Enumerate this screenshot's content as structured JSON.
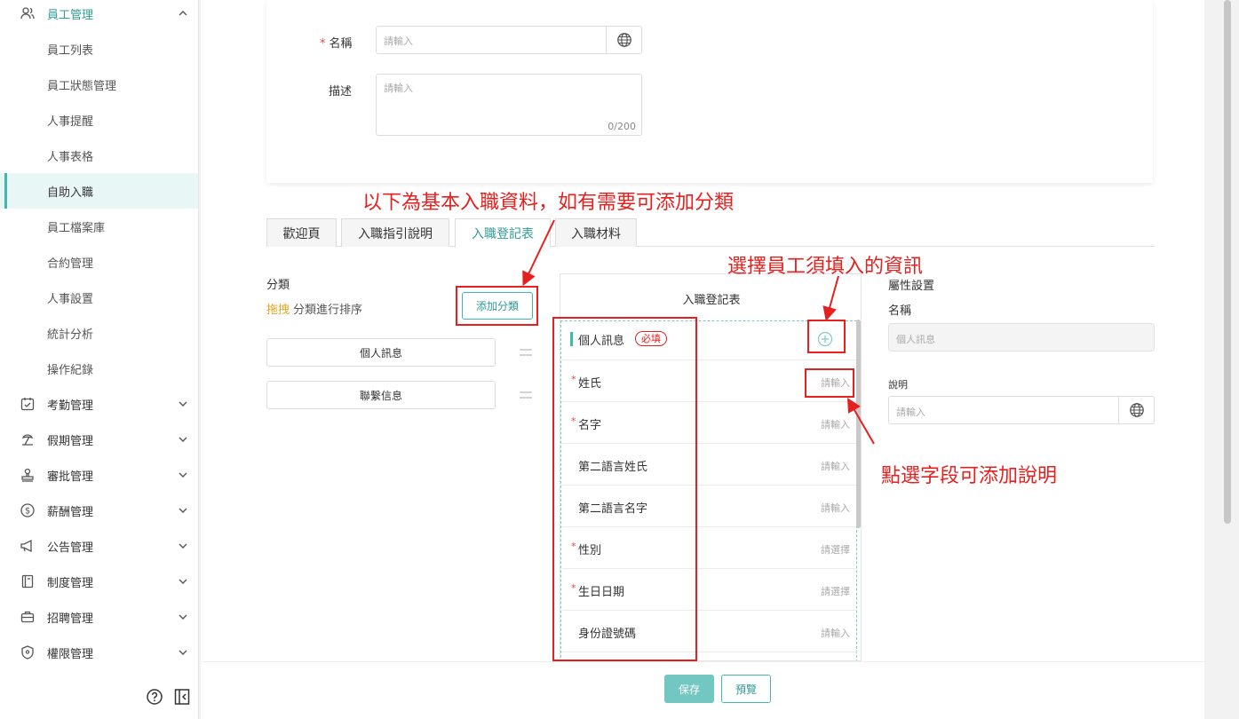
{
  "sidebar": {
    "items": [
      {
        "label": "員工管理",
        "icon": "users-icon",
        "expanded": true
      },
      {
        "label": "員工列表"
      },
      {
        "label": "員工狀態管理"
      },
      {
        "label": "人事提醒"
      },
      {
        "label": "人事表格"
      },
      {
        "label": "自助入職",
        "active": true
      },
      {
        "label": "員工檔案庫"
      },
      {
        "label": "合約管理"
      },
      {
        "label": "人事設置"
      },
      {
        "label": "統計分析"
      },
      {
        "label": "操作紀錄"
      },
      {
        "label": "考勤管理",
        "icon": "calendar-check-icon"
      },
      {
        "label": "假期管理",
        "icon": "beach-icon"
      },
      {
        "label": "審批管理",
        "icon": "stamp-icon"
      },
      {
        "label": "薪酬管理",
        "icon": "dollar-icon"
      },
      {
        "label": "公告管理",
        "icon": "megaphone-icon"
      },
      {
        "label": "制度管理",
        "icon": "book-icon"
      },
      {
        "label": "招聘管理",
        "icon": "briefcase-icon"
      },
      {
        "label": "權限管理",
        "icon": "shield-icon"
      }
    ]
  },
  "form": {
    "name_label": "名稱",
    "name_placeholder": "請輸入",
    "desc_label": "描述",
    "desc_placeholder": "請輸入",
    "desc_counter": "0/200"
  },
  "annotations": {
    "top": "以下為基本入職資料，如有需要可添加分類",
    "select_info": "選擇員工須填入的資訊",
    "click_field": "點選字段可添加說明"
  },
  "tabs": [
    "歡迎頁",
    "入職指引說明",
    "入職登記表",
    "入職材料"
  ],
  "active_tab": "入職登記表",
  "categories": {
    "title": "分類",
    "drag_word": "拖拽",
    "hint": "分類進行排序",
    "add_button": "添加分類",
    "items": [
      "個人訊息",
      "聯繫信息"
    ]
  },
  "register_form": {
    "title": "入職登記表",
    "group": {
      "label": "個人訊息",
      "badge": "必填"
    },
    "fields": [
      {
        "label": "姓氏",
        "required": true,
        "placeholder": "請輸入"
      },
      {
        "label": "名字",
        "required": true,
        "placeholder": "請輸入"
      },
      {
        "label": "第二語言姓氏",
        "required": false,
        "placeholder": "請輸入"
      },
      {
        "label": "第二語言名字",
        "required": false,
        "placeholder": "請輸入"
      },
      {
        "label": "性別",
        "required": true,
        "placeholder": "請選擇"
      },
      {
        "label": "生日日期",
        "required": true,
        "placeholder": "請選擇"
      },
      {
        "label": "身份證號碼",
        "required": false,
        "placeholder": "請輸入"
      }
    ]
  },
  "properties": {
    "title": "屬性設置",
    "name_label": "名稱",
    "name_value": "個人訊息",
    "desc_label": "說明",
    "desc_placeholder": "請輸入"
  },
  "footer": {
    "save": "保存",
    "preview": "預覽"
  },
  "colors": {
    "accent": "#3fb7b0",
    "annotation": "#e5201f",
    "drag": "#e8a21f"
  }
}
